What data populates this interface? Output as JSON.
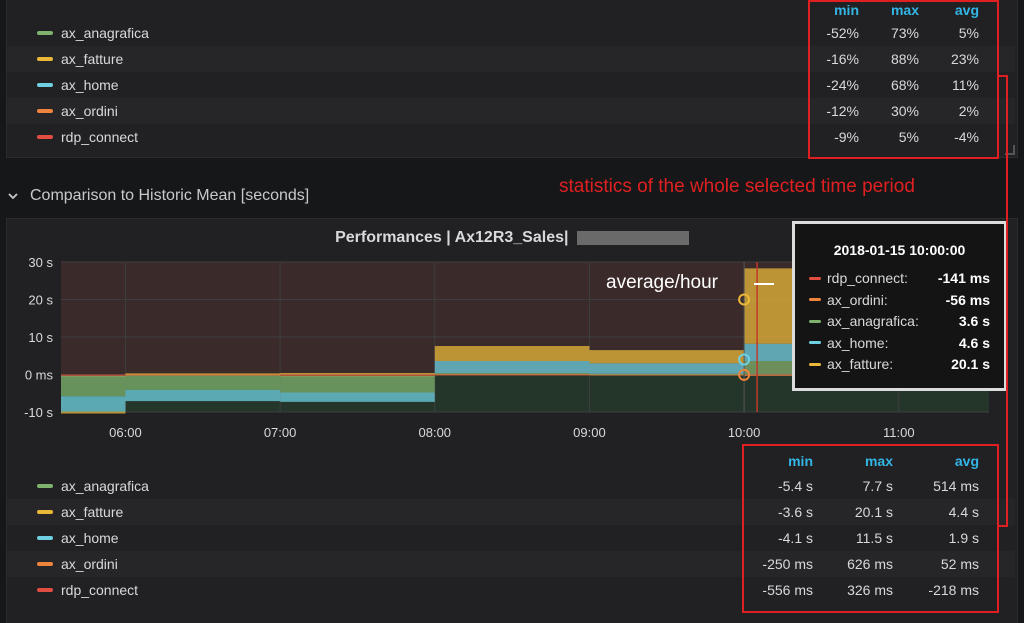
{
  "top_legend": {
    "headers": {
      "min": "min",
      "max": "max",
      "avg": "avg"
    },
    "rows": [
      {
        "name": "ax_anagrafica",
        "color": "#7eb26d",
        "min": "-52%",
        "max": "73%",
        "avg": "5%"
      },
      {
        "name": "ax_fatture",
        "color": "#eab839",
        "min": "-16%",
        "max": "88%",
        "avg": "23%"
      },
      {
        "name": "ax_home",
        "color": "#6ed0e0",
        "min": "-24%",
        "max": "68%",
        "avg": "11%"
      },
      {
        "name": "ax_ordini",
        "color": "#ef843c",
        "min": "-12%",
        "max": "30%",
        "avg": "2%"
      },
      {
        "name": "rdp_connect",
        "color": "#e24d42",
        "min": "-9%",
        "max": "5%",
        "avg": "-4%"
      }
    ]
  },
  "row_header": {
    "title": "Comparison to Historic Mean [seconds]",
    "icon": "chevron-down-icon"
  },
  "panel": {
    "title": "Performances | Ax12R3_Sales|"
  },
  "chart_data": {
    "type": "area",
    "title": "Performances | Ax12R3_Sales|",
    "y_ticks": [
      "30 s",
      "20 s",
      "10 s",
      "0 ms",
      "-10 s"
    ],
    "x_ticks": [
      "06:00",
      "07:00",
      "08:00",
      "09:00",
      "10:00",
      "11:00"
    ],
    "ylim": [
      -10,
      30
    ],
    "xlim": [
      "05:35",
      "11:35"
    ],
    "grid": true,
    "stacked": true,
    "series": [
      {
        "name": "rdp_connect",
        "color": "#e24d42",
        "x": [
          "05:35",
          "06:00",
          "07:00",
          "08:00",
          "09:00",
          "10:00"
        ],
        "values": [
          -0.3,
          -0.3,
          -0.3,
          -0.2,
          -0.2,
          -0.1
        ]
      },
      {
        "name": "ax_ordini",
        "color": "#ef843c",
        "x": [
          "05:35",
          "06:00",
          "07:00",
          "08:00",
          "09:00",
          "10:00"
        ],
        "values": [
          -0.1,
          0,
          -0.1,
          0.1,
          0,
          -0.1
        ]
      },
      {
        "name": "ax_anagrafica",
        "color": "#7eb26d",
        "x": [
          "05:35",
          "06:00",
          "07:00",
          "08:00",
          "09:00",
          "10:00"
        ],
        "values": [
          -5.4,
          -3.8,
          -4.4,
          0.3,
          0.2,
          3.6
        ]
      },
      {
        "name": "ax_home",
        "color": "#6ed0e0",
        "x": [
          "05:35",
          "06:00",
          "07:00",
          "08:00",
          "09:00",
          "10:00"
        ],
        "values": [
          -4.1,
          -3,
          -2.5,
          3.2,
          2.8,
          4.6
        ]
      },
      {
        "name": "ax_fatture",
        "color": "#eab839",
        "x": [
          "05:35",
          "06:00",
          "07:00",
          "08:00",
          "09:00",
          "10:00"
        ],
        "values": [
          -0.5,
          0.3,
          0.4,
          4,
          3.5,
          20.1
        ]
      }
    ]
  },
  "tooltip": {
    "time": "2018-01-15 10:00:00",
    "rows": [
      {
        "name": "rdp_connect:",
        "color": "#e24d42",
        "value": "-141 ms"
      },
      {
        "name": "ax_ordini:",
        "color": "#ef843c",
        "value": "-56 ms"
      },
      {
        "name": "ax_anagrafica:",
        "color": "#7eb26d",
        "value": "3.6 s"
      },
      {
        "name": "ax_home:",
        "color": "#6ed0e0",
        "value": "4.6 s"
      },
      {
        "name": "ax_fatture:",
        "color": "#eab839",
        "value": "20.1 s"
      }
    ]
  },
  "bottom_legend": {
    "headers": {
      "min": "min",
      "max": "max",
      "avg": "avg"
    },
    "rows": [
      {
        "name": "ax_anagrafica",
        "color": "#7eb26d",
        "min": "-5.4 s",
        "max": "7.7 s",
        "avg": "514 ms"
      },
      {
        "name": "ax_fatture",
        "color": "#eab839",
        "min": "-3.6 s",
        "max": "20.1 s",
        "avg": "4.4 s"
      },
      {
        "name": "ax_home",
        "color": "#6ed0e0",
        "min": "-4.1 s",
        "max": "11.5 s",
        "avg": "1.9 s"
      },
      {
        "name": "ax_ordini",
        "color": "#ef843c",
        "min": "-250 ms",
        "max": "626 ms",
        "avg": "52 ms"
      },
      {
        "name": "rdp_connect",
        "color": "#e24d42",
        "min": "-556 ms",
        "max": "326 ms",
        "avg": "-218 ms"
      }
    ]
  },
  "annotations": {
    "stats_label": "statistics of the whole selected time period",
    "avg_label": "average/hour",
    "annotation_color": "#e02020"
  }
}
